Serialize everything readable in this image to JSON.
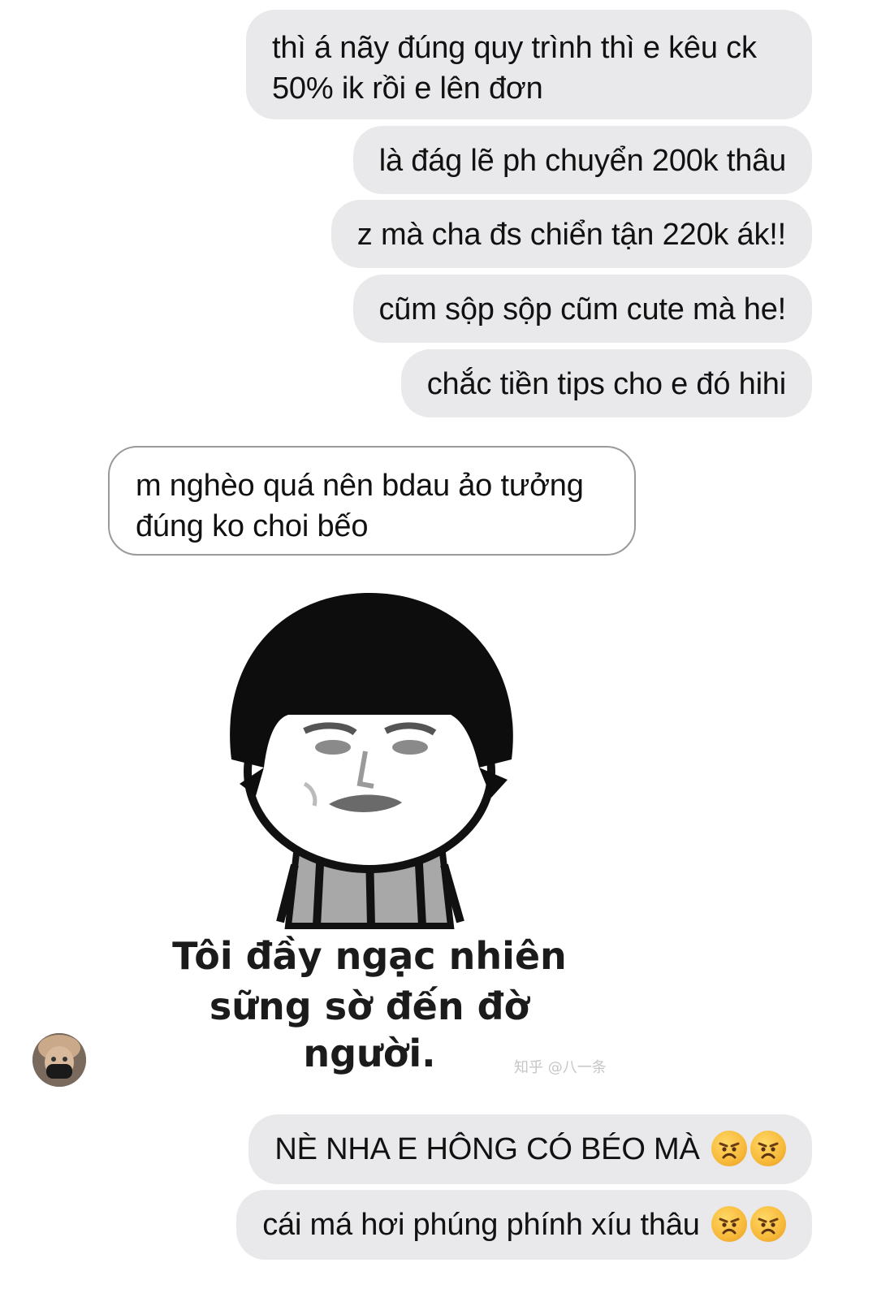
{
  "messages": {
    "m1": "thì á nãy đúng quy trình thì e kêu ck 50% ik rồi e lên đơn",
    "m2": "là đág lẽ ph chuyển 200k thâu",
    "m3": "z mà cha đs chiển tận 220k ák!!",
    "m4": "cũm sộp sộp cũm cute mà he!",
    "m5": "chắc tiền tips cho e đó hihi",
    "reply": "m nghèo quá nên bdau ảo tưởng đúng ko choi bếo",
    "m6": "NÈ NHA E HÔNG CÓ BÉO MÀ",
    "m7": "cái má hơi phúng phính xíu thâu"
  },
  "sticker": {
    "caption_line1": "Tôi đầy ngạc nhiên",
    "caption_line2": "sững sờ đến đờ người.",
    "watermark": "知乎 @八一条"
  },
  "emoji": {
    "name": "angry-face-icon",
    "color": "#f7b93a"
  },
  "colors": {
    "outgoing_bubble": "#e9e9eb",
    "incoming_border": "#9a9a9a"
  }
}
